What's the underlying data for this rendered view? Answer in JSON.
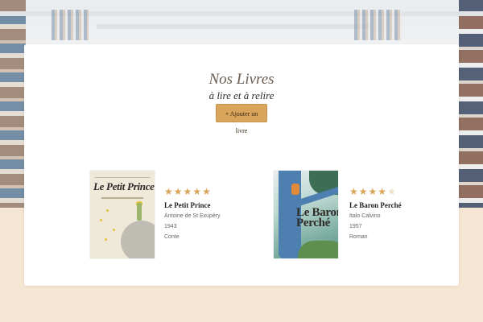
{
  "header": {
    "title": "Nos Livres",
    "subtitle": "à lire et à relire",
    "add_button_label": "+ Ajouter un livre"
  },
  "books": [
    {
      "cover_text": "Le Petit Prince",
      "rating": 5,
      "title": "Le Petit Prince",
      "author": "Antoine de St Exupéry",
      "year": "1943",
      "genre": "Conte"
    },
    {
      "cover_text": "Le Baron Perché",
      "rating": 4,
      "title": "Le Baron Perché",
      "author": "Italo Calvino",
      "year": "1957",
      "genre": "Roman"
    }
  ],
  "icons": {
    "rating": "star-icon"
  },
  "colors": {
    "accent": "#d9a55a",
    "page_background": "#f4e6d2",
    "title": "#6b5d52"
  }
}
